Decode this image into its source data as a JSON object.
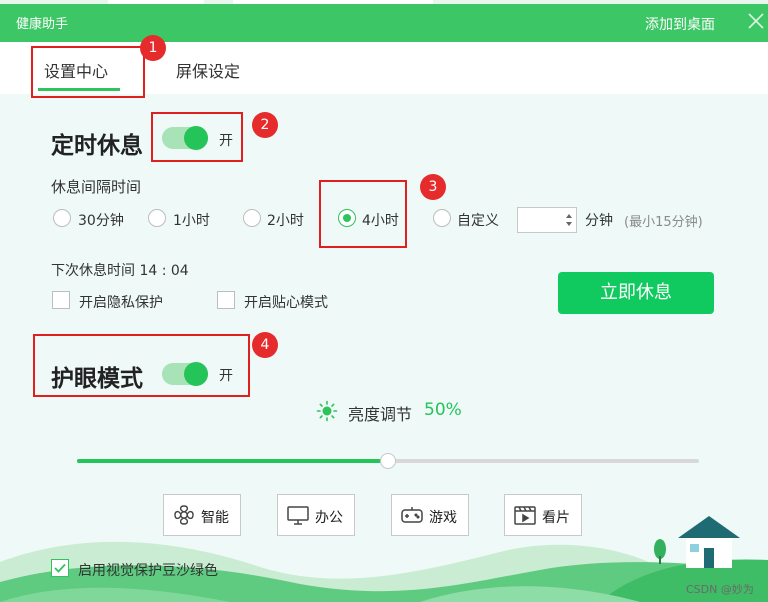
{
  "app": {
    "title": "健康助手",
    "add_to_desktop": "添加到桌面"
  },
  "tabs": [
    {
      "label": "设置中心",
      "active": true
    },
    {
      "label": "屏保设定",
      "active": false
    }
  ],
  "rest": {
    "title": "定时休息",
    "toggle_state": "开",
    "interval_label": "休息间隔时间",
    "options": [
      {
        "label": "30分钟",
        "checked": false
      },
      {
        "label": "1小时",
        "checked": false
      },
      {
        "label": "2小时",
        "checked": false
      },
      {
        "label": "4小时",
        "checked": true
      },
      {
        "label": "自定义",
        "checked": false
      }
    ],
    "custom_value": "",
    "custom_unit": "分钟",
    "custom_hint": "(最小15分钟)",
    "next_rest": "下次休息时间 14 : 04",
    "privacy_label": "开启隐私保护",
    "intimate_label": "开启贴心模式",
    "rest_now_button": "立即休息"
  },
  "eye": {
    "title": "护眼模式",
    "toggle_state": "开",
    "brightness_label": "亮度调节",
    "brightness_value": "50%",
    "brightness_fraction": 0.5,
    "modes": [
      {
        "label": "智能",
        "icon": "smart-icon"
      },
      {
        "label": "办公",
        "icon": "monitor-icon"
      },
      {
        "label": "游戏",
        "icon": "gamepad-icon"
      },
      {
        "label": "看片",
        "icon": "film-icon"
      }
    ],
    "eye_protection_color_label": "启用视觉保护豆沙绿色",
    "eye_protection_color_checked": true
  },
  "annotations": [
    "1",
    "2",
    "3",
    "4"
  ],
  "watermark": "CSDN @妙为",
  "colors": {
    "brand_green": "#3dc665",
    "accent": "#23c45a",
    "annotation_red": "#e0201e"
  }
}
